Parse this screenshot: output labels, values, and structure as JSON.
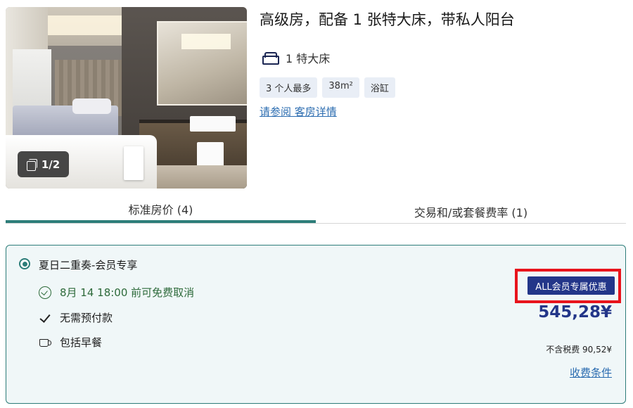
{
  "photo": {
    "counter": "1/2"
  },
  "room": {
    "title": "高级房，配备 1 张特大床，带私人阳台",
    "bed": "1 特大床",
    "tags": [
      "3 个人最多",
      "38m²",
      "浴缸"
    ],
    "details_link": "请参阅 客房详情"
  },
  "tabs": [
    {
      "label": "标准房价 (4)",
      "active": true
    },
    {
      "label": "交易和/或套餐费率 (1)",
      "active": false
    }
  ],
  "rate": {
    "name": "夏日二重奏-会员专享",
    "cancel": "8月 14 18:00 前可免费取消",
    "no_prepay": "无需预付款",
    "breakfast": "包括早餐",
    "promo_badge": "ALL会员专属优惠",
    "price": "545,28¥",
    "tax": "不含税费 90,52¥",
    "terms": "收费条件"
  },
  "colors": {
    "accent": "#2d7d79",
    "brand": "#233689",
    "highlight": "#e8141c"
  }
}
